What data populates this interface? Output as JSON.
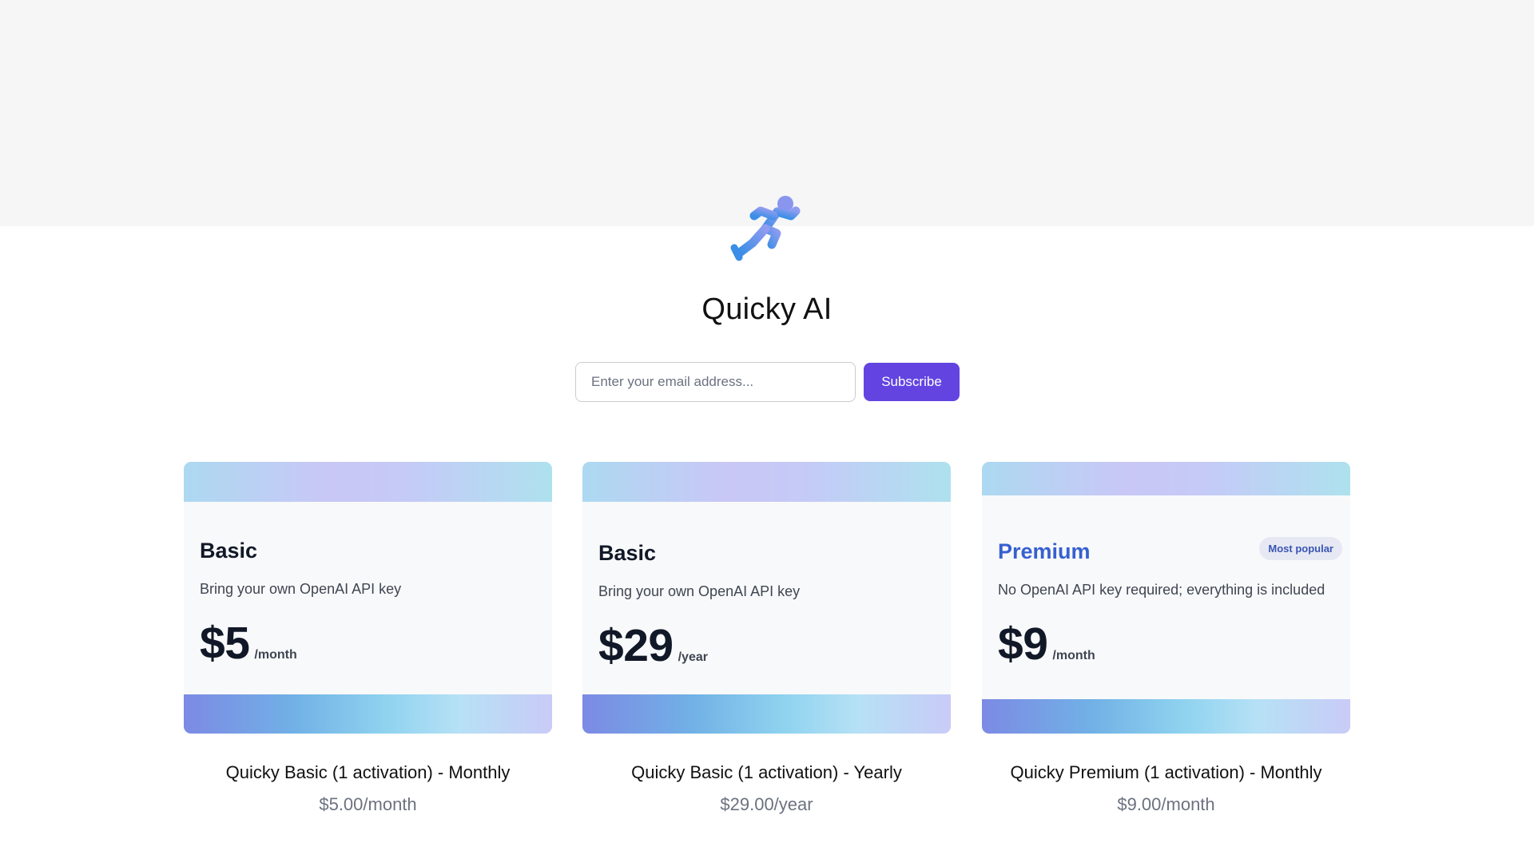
{
  "app": {
    "title": "Quicky AI",
    "logo_icon": "running-person-icon"
  },
  "subscribe": {
    "placeholder": "Enter your email address...",
    "button_label": "Subscribe",
    "button_color": "#6344e0"
  },
  "plans": [
    {
      "tier": "Basic",
      "description": "Bring your own OpenAI API key",
      "price": "$5",
      "period": "/month",
      "product_name": "Quicky Basic (1 activation) - Monthly",
      "product_price": "$5.00/month"
    },
    {
      "tier": "Basic",
      "description": "Bring your own OpenAI API key",
      "price": "$29",
      "period": "/year",
      "product_name": "Quicky Basic (1 activation) - Yearly",
      "product_price": "$29.00/year"
    },
    {
      "tier": "Premium",
      "badge": "Most popular",
      "description": "No OpenAI API key required; everything is included",
      "price": "$9",
      "period": "/month",
      "product_name": "Quicky Premium (1 activation) - Monthly",
      "product_price": "$9.00/month",
      "accent_color": "#3760d0"
    }
  ]
}
